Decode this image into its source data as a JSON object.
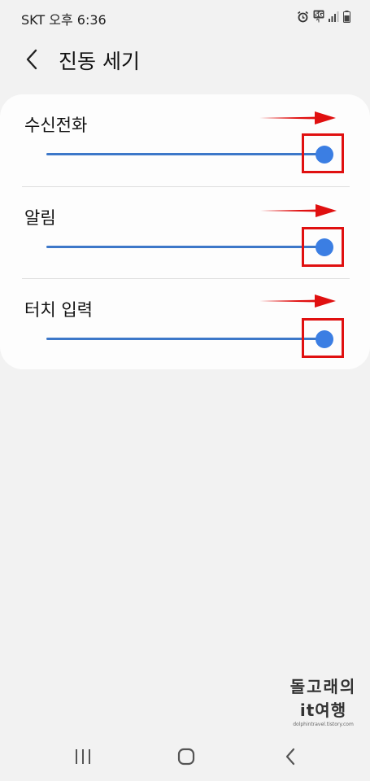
{
  "status_bar": {
    "carrier_time": "SKT 오후 6:36",
    "icons": [
      "alarm-icon",
      "5g-icon",
      "signal-icon",
      "battery-icon"
    ]
  },
  "header": {
    "title": "진동 세기",
    "back_icon": "chevron-left-icon"
  },
  "sliders": [
    {
      "label": "수신전화",
      "level": 1.0
    },
    {
      "label": "알림",
      "level": 1.0
    },
    {
      "label": "터치 입력",
      "level": 1.0
    }
  ],
  "watermark": {
    "line1": "돌고래의",
    "line2": "it여행",
    "url": "dolphintravel.tistory.com"
  },
  "nav_bar": {
    "icons": [
      "recent-apps-icon",
      "home-icon",
      "back-icon"
    ]
  },
  "colors": {
    "accent": "#3b7ee3",
    "track": "#3d78c9",
    "annotation": "#e01010",
    "background": "#f2f2f2",
    "card": "#fdfdfd"
  }
}
